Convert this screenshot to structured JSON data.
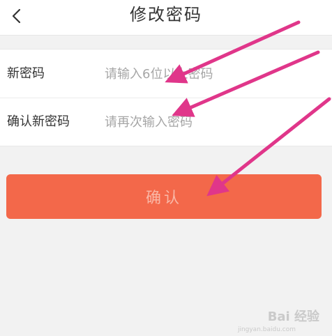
{
  "header": {
    "title": "修改密码",
    "back_icon": "chevron-left-icon"
  },
  "form": {
    "new_password": {
      "label": "新密码",
      "placeholder": "请输入6位以上密码",
      "value": ""
    },
    "confirm_password": {
      "label": "确认新密码",
      "placeholder": "请再次输入密码",
      "value": ""
    }
  },
  "confirm_button": {
    "label": "确认"
  },
  "watermark": {
    "text": "Bai 经验",
    "sub": "jingyan.baidu.com"
  },
  "colors": {
    "accent": "#f3684a",
    "arrow": "#e0368a",
    "background": "#f2f2f2"
  }
}
